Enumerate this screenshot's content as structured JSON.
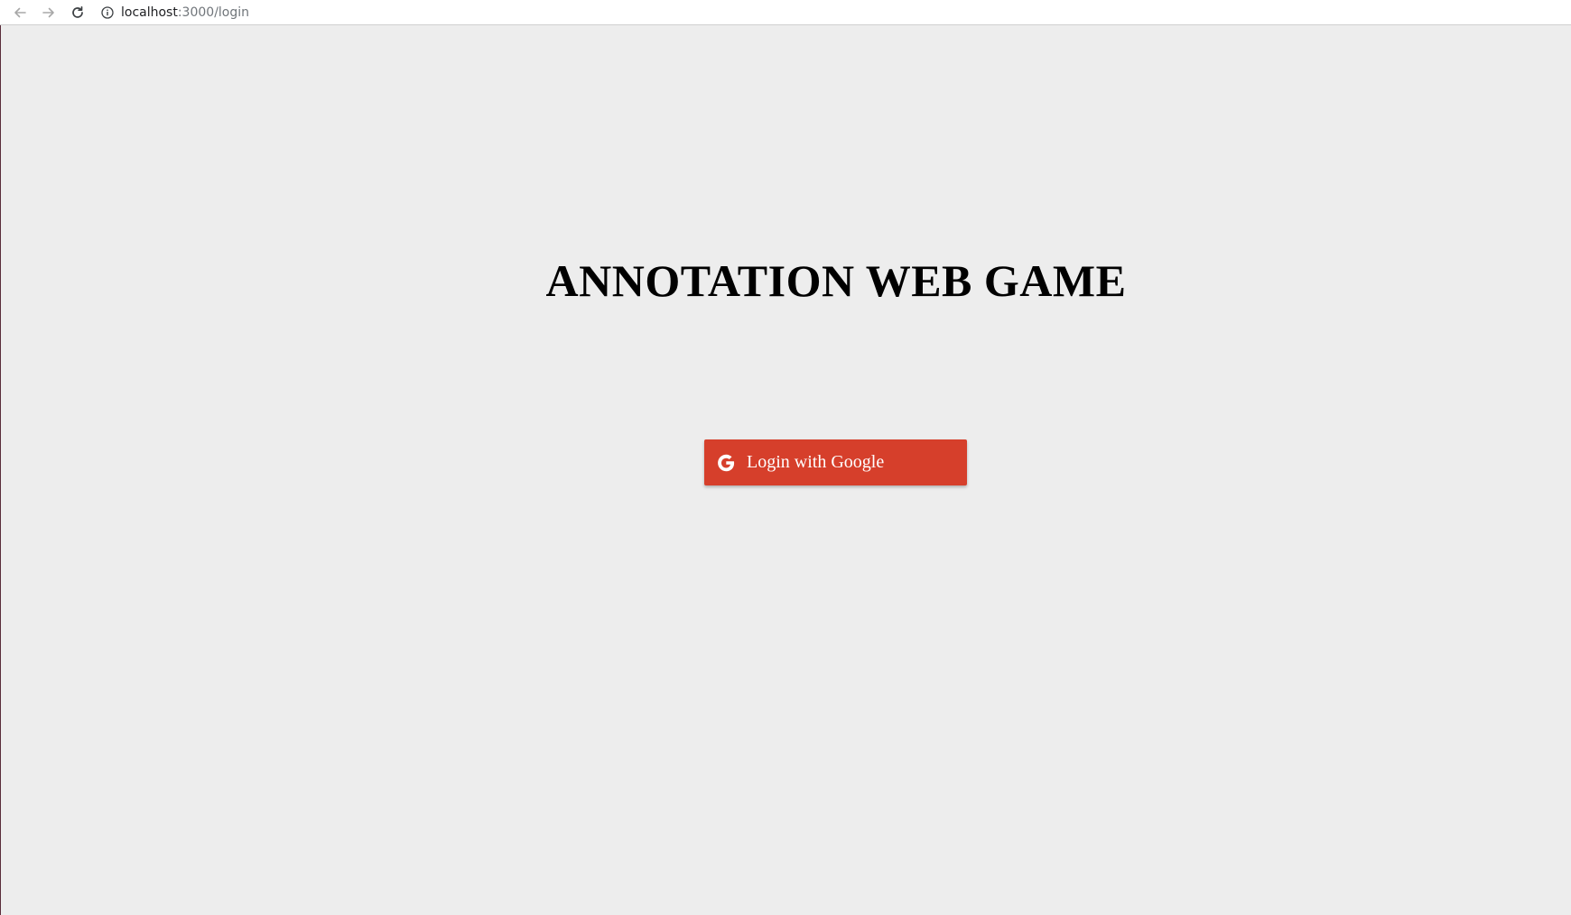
{
  "browser": {
    "url_host": "localhost",
    "url_path": ":3000/login",
    "icons": {
      "back": "arrow-left-icon",
      "forward": "arrow-right-icon",
      "reload": "reload-icon",
      "info": "info-icon"
    }
  },
  "page": {
    "title": "ANNOTATION WEB GAME",
    "login_button": {
      "label": "Login with Google",
      "icon": "google-icon",
      "color": "#d63f2b"
    },
    "background_color": "#ededed"
  }
}
